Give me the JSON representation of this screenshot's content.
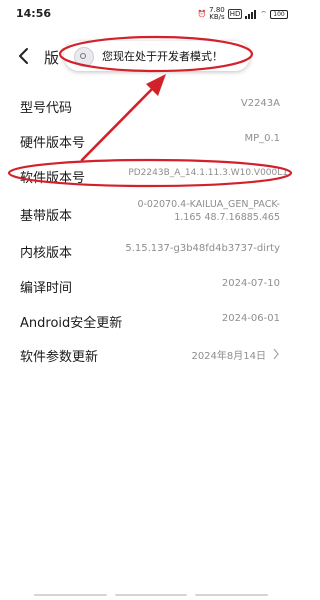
{
  "status_bar": {
    "time": "14:56",
    "speed": "7.80",
    "speed_unit": "KB/s",
    "network_tag": "HD",
    "network_tag2": "5G",
    "battery": "100"
  },
  "header": {
    "title_partial": "版"
  },
  "toast": {
    "message": "您现在处于开发者模式！"
  },
  "rows": [
    {
      "label": "型号代码",
      "value": "V2243A"
    },
    {
      "label": "硬件版本号",
      "value": "MP_0.1"
    },
    {
      "label": "软件版本号",
      "value": "PD2243B_A_14.1.11.3.W10.V000L1"
    },
    {
      "label": "基带版本",
      "value": "0-02070.4-KAILUA_GEN_PACK-1.165 48.7.16885.465"
    },
    {
      "label": "内核版本",
      "value": "5.15.137-g3b48fd4b3737-dirty"
    },
    {
      "label": "编译时间",
      "value": "2024-07-10"
    },
    {
      "label": "Android安全更新",
      "value": "2024-06-01"
    },
    {
      "label": "软件参数更新",
      "value": "2024年8月14日"
    }
  ],
  "annotation_color": "#d3212b"
}
